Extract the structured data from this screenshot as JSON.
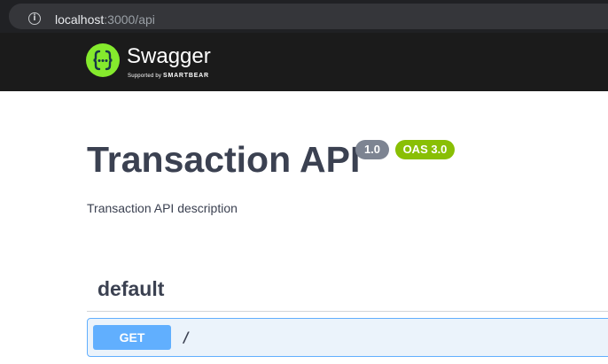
{
  "browser": {
    "url_host": "localhost",
    "url_rest": ":3000/api",
    "info_icon": "info-icon"
  },
  "topbar": {
    "brand_name": "Swagger",
    "brand_sub_prefix": "Supported by",
    "brand_company": "SMARTBEAR",
    "logo_glyph": "{...}",
    "logo_icon": "swagger-logo-icon"
  },
  "info": {
    "title": "Transaction API",
    "version": "1.0",
    "oas_version": "OAS 3.0",
    "description": "Transaction API description"
  },
  "tag": {
    "name": "default"
  },
  "operations": [
    {
      "method": "GET",
      "path": "/"
    }
  ],
  "colors": {
    "topbar_bg": "#1b1b1b",
    "swagger_green": "#85ea2d",
    "version_badge": "#7d8492",
    "oas_badge": "#89bf04",
    "get_method": "#61affe",
    "get_block_bg": "#ebf3fb",
    "text_primary": "#3b4151"
  }
}
